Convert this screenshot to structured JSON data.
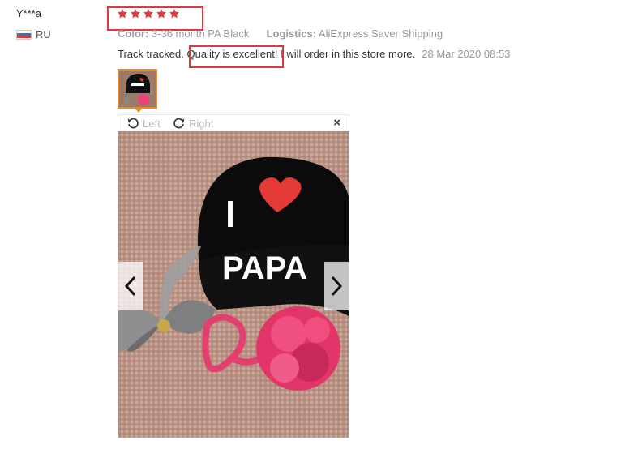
{
  "review": {
    "reviewer": "Y***a",
    "country_code": "RU",
    "rating": 5,
    "color_label": "Color:",
    "color_value": "3-36 month PA Black",
    "logistics_label": "Logistics:",
    "logistics_value": "AliExpress Saver Shipping",
    "text_before": "Track tracked. ",
    "text_highlight": "Quality is excellent!",
    "text_after": " I will order in this store more.",
    "date": "28 Mar 2020 08:53"
  },
  "viewer": {
    "rotate_left_label": "Left",
    "rotate_right_label": "Right",
    "close_symbol": "×",
    "prev_icon": "chevron-left-icon",
    "next_icon": "chevron-right-icon",
    "hat_text_i": "I",
    "hat_text_papa": "PAPA"
  },
  "colors": {
    "star": "#e2373b",
    "highlight": "#e2373b",
    "thumb_border": "#e68a2e",
    "meta_text": "#999999"
  }
}
